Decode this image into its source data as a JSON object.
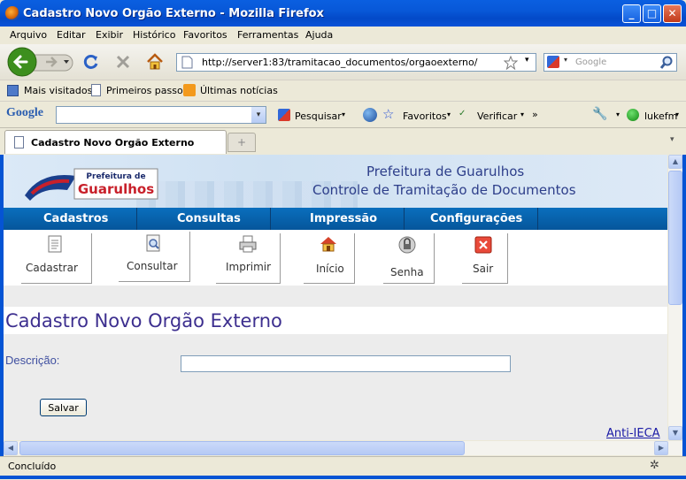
{
  "window": {
    "title": "Cadastro Novo Orgão Externo - Mozilla Firefox"
  },
  "menu": [
    "Arquivo",
    "Editar",
    "Exibir",
    "Histórico",
    "Favoritos",
    "Ferramentas",
    "Ajuda"
  ],
  "nav": {
    "url": "http://server1:83/tramitacao_documentos/orgaoexterno/",
    "search_placeholder": "Google"
  },
  "bookmarks": [
    "Mais visitados",
    "Primeiros passos",
    "Últimas notícias"
  ],
  "googlebar": {
    "logo": "Google",
    "search_label": "Pesquisar",
    "favorites_label": "Favoritos",
    "check_label": "Verificar",
    "more": "»",
    "user": "lukefm"
  },
  "tab": {
    "title": "Cadastro Novo Orgão Externo",
    "new_tab": "+"
  },
  "page": {
    "banner": {
      "logo_top": "Prefeitura de",
      "logo_main": "Guarulhos",
      "title1": "Prefeitura de Guarulhos",
      "title2": "Controle de Tramitação de Documentos"
    },
    "nav_menu": [
      "Cadastros",
      "Consultas",
      "Impressão",
      "Configurações"
    ],
    "icons": [
      "Cadastrar",
      "Consultar",
      "Imprimir",
      "Início",
      "Senha",
      "Sair"
    ],
    "heading": "Cadastro Novo Orgão Externo",
    "form": {
      "label": "Descrição:",
      "value": "",
      "save": "Salvar"
    },
    "link": "Anti-IECA"
  },
  "status": {
    "text": "Concluído"
  },
  "icons": {
    "back": "back-arrow-icon",
    "forward": "forward-arrow-icon",
    "reload": "reload-icon",
    "stop": "stop-icon",
    "home": "home-icon",
    "star": "star-icon"
  },
  "colors": {
    "title_bar": "#0558d6",
    "nav_menu": "#0762ab",
    "heading": "#3d2f8f",
    "label": "#3f4fa0",
    "link": "#1a1aa6"
  }
}
